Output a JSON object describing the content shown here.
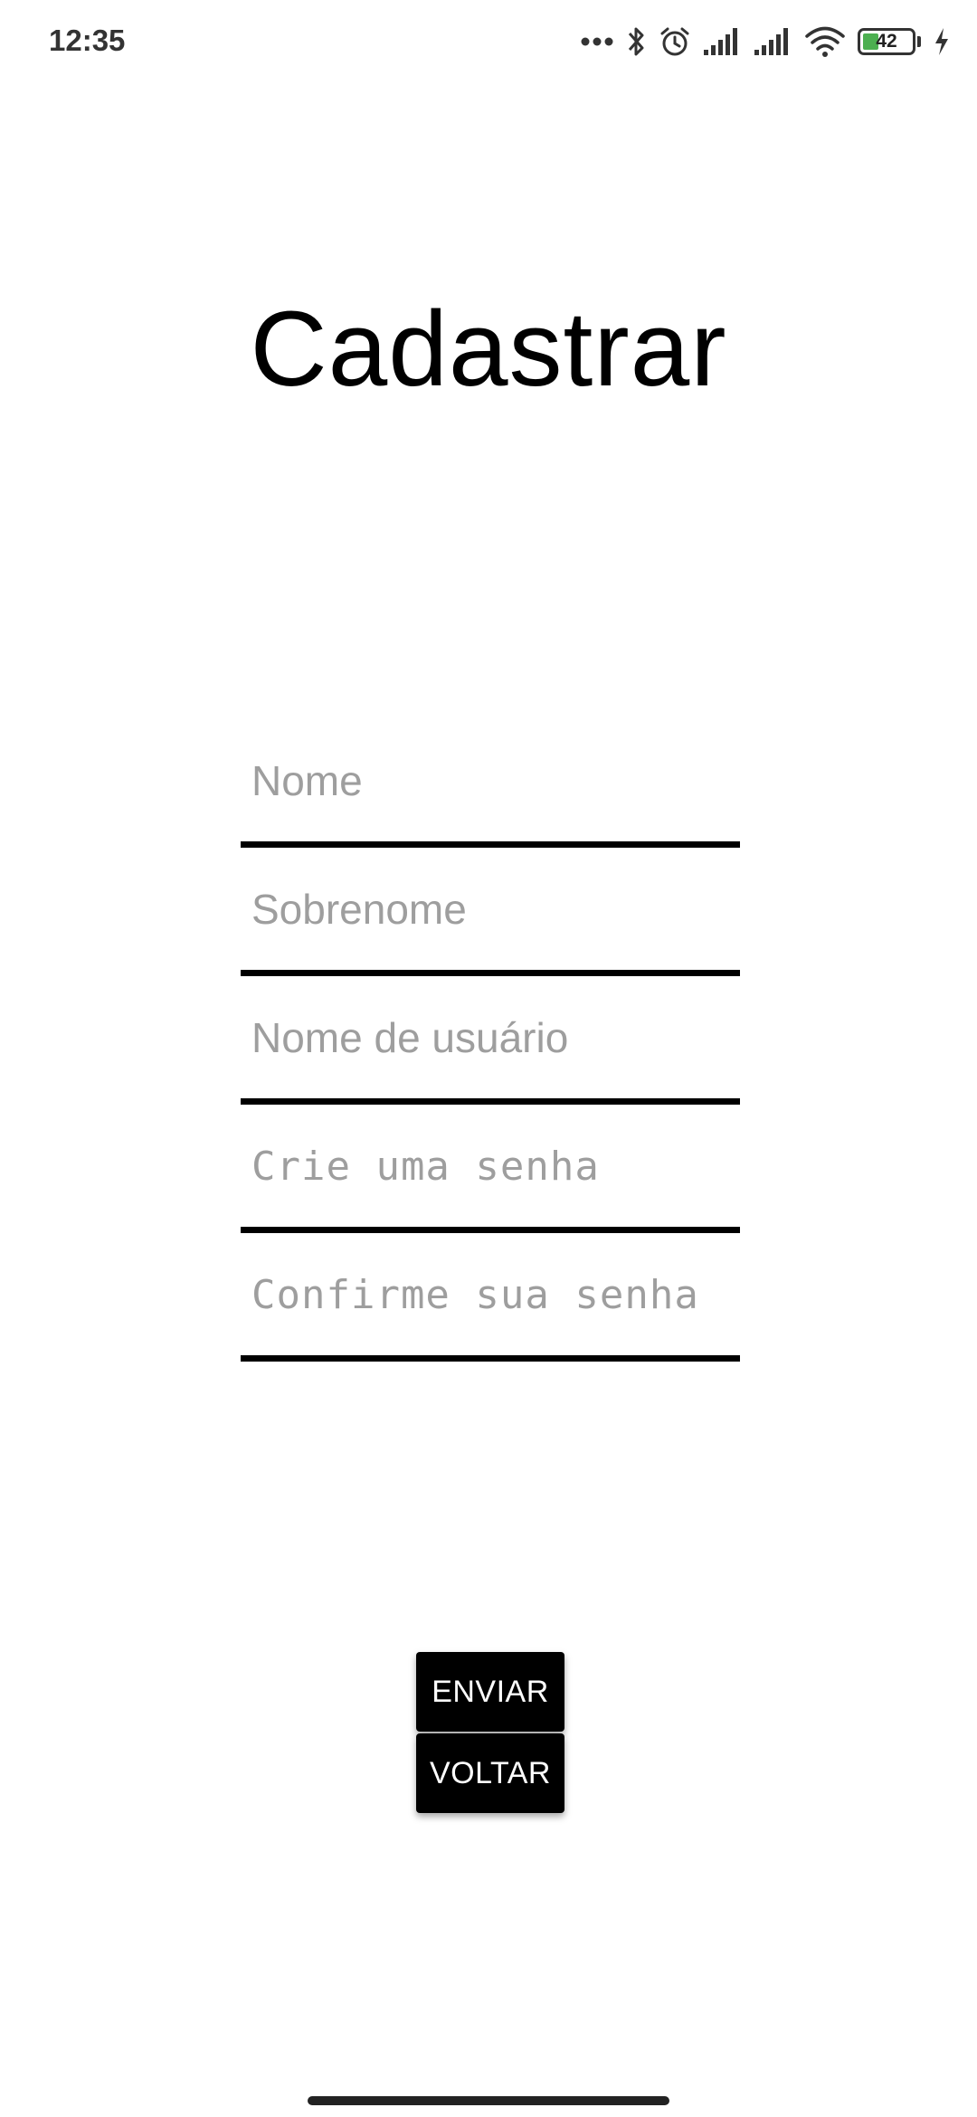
{
  "status_bar": {
    "time": "12:35",
    "battery_level": "42",
    "icons": [
      "more-dots-icon",
      "bluetooth-icon",
      "alarm-icon",
      "signal-icon",
      "signal-icon",
      "wifi-icon",
      "battery-icon",
      "charging-icon"
    ]
  },
  "page": {
    "title": "Cadastrar"
  },
  "form": {
    "first_name_placeholder": "Nome",
    "last_name_placeholder": "Sobrenome",
    "username_placeholder": "Nome de usuário",
    "password_placeholder": "Crie uma senha",
    "confirm_password_placeholder": "Confirme sua senha"
  },
  "actions": {
    "send_label": "ENVIAR",
    "back_label": "VOLTAR"
  },
  "colors": {
    "background": "#ffffff",
    "text": "#000000",
    "placeholder": "#9e9e9e",
    "button_bg": "#000000",
    "button_text": "#ffffff",
    "battery_fill": "#4caf50"
  }
}
